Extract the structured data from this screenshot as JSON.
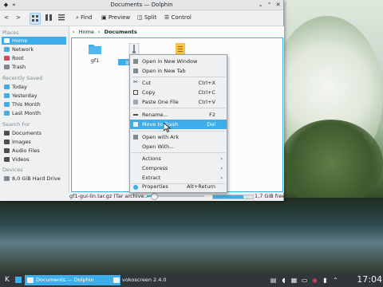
{
  "window": {
    "title": "Documents — Dolphin"
  },
  "toolbar": {
    "find_label": "Find",
    "preview_label": "Preview",
    "split_label": "Split",
    "control_label": "Control"
  },
  "places": {
    "sections": [
      {
        "header": "Places",
        "items": [
          "Home",
          "Network",
          "Root",
          "Trash"
        ]
      },
      {
        "header": "Recently Saved",
        "items": [
          "Today",
          "Yesterday",
          "This Month",
          "Last Month"
        ]
      },
      {
        "header": "Search For",
        "items": [
          "Documents",
          "Images",
          "Audio Files",
          "Videos"
        ]
      },
      {
        "header": "Devices",
        "items": [
          "8,0 GiB Hard Drive"
        ]
      }
    ],
    "selected": "Home"
  },
  "breadcrumb": {
    "home": "Home",
    "sep": "›",
    "current": "Documents"
  },
  "files": [
    {
      "name": "gf1",
      "type": "folder"
    },
    {
      "name": "gf1-gu",
      "type": "archive",
      "selected": true
    },
    {
      "name": "",
      "type": "document"
    }
  ],
  "status": {
    "text": "gf1-gui-lin.tar.gz (Tar archive...",
    "disk_free": "1,7 GiB free",
    "zoom_fraction": 0.12,
    "disk_used_fraction": 0.75
  },
  "context_menu": {
    "items": [
      {
        "label": "Open in New Window",
        "shortcut": ""
      },
      {
        "label": "Open in New Tab",
        "shortcut": ""
      },
      {
        "label": "Cut",
        "shortcut": "Ctrl+X"
      },
      {
        "label": "Copy",
        "shortcut": "Ctrl+C"
      },
      {
        "label": "Paste One File",
        "shortcut": "Ctrl+V"
      },
      {
        "label": "Rename...",
        "shortcut": "F2"
      },
      {
        "label": "Move to Trash",
        "shortcut": "Del",
        "highlighted": true
      },
      {
        "label": "Open with Ark",
        "shortcut": ""
      },
      {
        "label": "Open With...",
        "shortcut": ""
      },
      {
        "label": "Actions",
        "submenu": true
      },
      {
        "label": "Compress",
        "submenu": true
      },
      {
        "label": "Extract",
        "submenu": true
      },
      {
        "label": "Properties",
        "shortcut": "Alt+Return"
      }
    ]
  },
  "taskbar": {
    "tasks": [
      {
        "label": "Documents — Dolphin",
        "active": true
      },
      {
        "label": "vokoscreen 2.4.0",
        "active": false
      }
    ],
    "clock": "17:04"
  },
  "colors": {
    "accent": "#3daee9",
    "panel": "#31363b",
    "window_bg": "#eff0f1"
  }
}
